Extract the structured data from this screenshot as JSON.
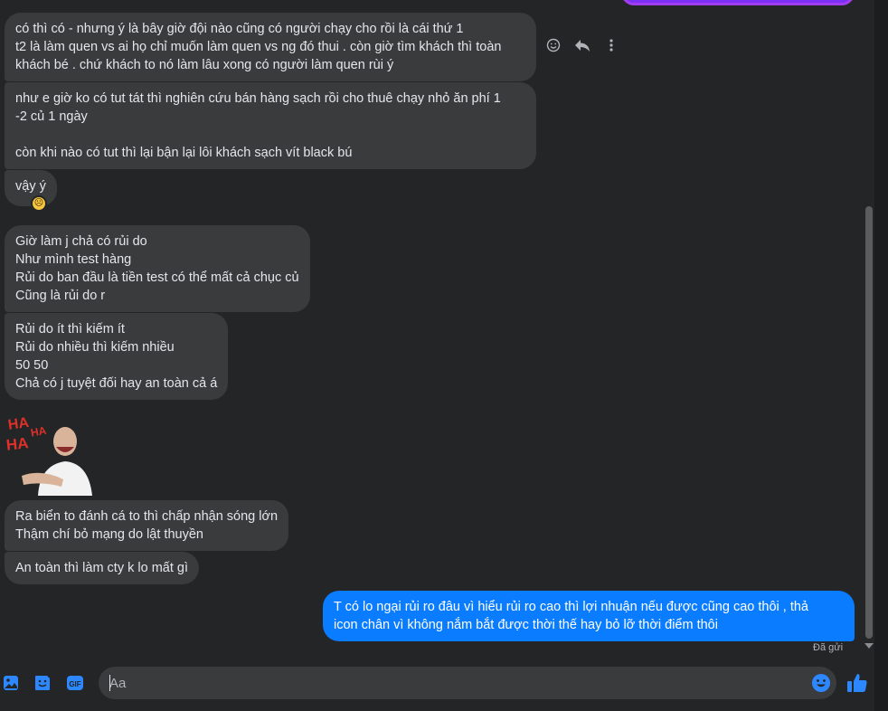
{
  "messages": {
    "m1": "có thì có - nhưng ý là bây giờ đội nào cũng có người chạy cho rồi là cái thứ 1\nt2 là làm quen vs ai họ chỉ muốn làm quen vs ng đó thui . còn giờ tìm khách thì toàn\nkhách bé . chứ khách to nó làm lâu xong có người làm quen rùi ý",
    "m2": "như e giờ ko có tut tát thì nghiên cứu bán hàng sạch rồi cho thuê chạy nhỏ ăn phí 1\n-2 củ 1 ngày\n\ncòn khi nào có tut thì lại bận lại lôi khách sạch vít black bú",
    "m3": "vậy ý",
    "m4": "Giờ làm j chả có rủi do\nNhư mình test hàng\nRủi do ban đầu là tiền test có thể mất cả chục củ\nCũng là rủi do r",
    "m5": "Rủi do ít thì kiếm ít\nRủi do nhiều thì kiếm nhiều\n50 50\nChả có j tuyệt đối hay an toàn cả á",
    "m6": "Ra biển to đánh cá to thì chấp nhận sóng lớn\nThậm chí bỏ mạng do lật thuyền",
    "m7": "An toàn thì làm cty k lo mất gì",
    "out": "T có lo ngại rủi ro đâu vì hiểu rủi ro cao thì lợi nhuận nếu được cũng cao thôi , thả\nicon chân vì không nắm bắt được thời thế hay bỏ lỡ thời điểm thôi"
  },
  "sticker_text": "HA HA HA",
  "seen_status": "Đã gửi",
  "composer": {
    "placeholder": "Aa"
  },
  "icons": {
    "reaction": "sad-face-icon",
    "actions": [
      "react-icon",
      "reply-icon",
      "more-icon"
    ],
    "composer": [
      "image-icon",
      "sticker-icon",
      "gif-icon",
      "emoji-icon",
      "like-icon"
    ]
  },
  "colors": {
    "outgoing": "#0a7cff",
    "incoming": "#3a3b3c",
    "background": "#242526",
    "accent": "#0a7cff"
  }
}
